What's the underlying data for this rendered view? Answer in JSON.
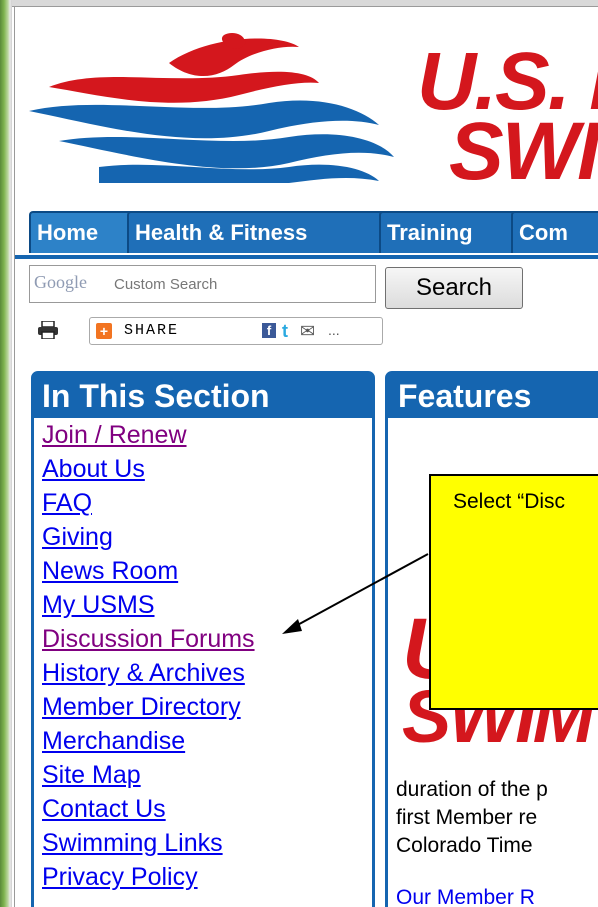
{
  "logo": {
    "line1": "U.S. M",
    "line2": "SWI"
  },
  "nav": {
    "tabs": [
      "Home",
      "Health & Fitness",
      "Training",
      "Com"
    ]
  },
  "search": {
    "google_text": "Google",
    "placeholder": "Custom Search",
    "button_label": "Search"
  },
  "share": {
    "label": "SHARE",
    "more": "..."
  },
  "section": {
    "title": "In This Section",
    "links": [
      {
        "label": "Join / Renew",
        "visited": true
      },
      {
        "label": "About Us",
        "visited": false
      },
      {
        "label": "FAQ",
        "visited": false
      },
      {
        "label": "Giving",
        "visited": false
      },
      {
        "label": "News Room",
        "visited": false
      },
      {
        "label": "My USMS",
        "visited": false
      },
      {
        "label": "Discussion Forums",
        "visited": true
      },
      {
        "label": "History & Archives",
        "visited": false
      },
      {
        "label": "Member Directory",
        "visited": false
      },
      {
        "label": "Merchandise",
        "visited": false
      },
      {
        "label": "Site Map",
        "visited": false
      },
      {
        "label": "Contact Us",
        "visited": false
      },
      {
        "label": "Swimming Links",
        "visited": false
      },
      {
        "label": "Privacy Policy",
        "visited": false
      }
    ]
  },
  "features": {
    "title": "Features",
    "logo_line1": "U",
    "logo_line2": "SWIM",
    "body_lines": [
      "duration of the p",
      "first Member re",
      "Colorado Time"
    ],
    "more_text": "Our Member R"
  },
  "callout": {
    "text": "Select “Disc"
  },
  "colors": {
    "brand_red": "#d4171d",
    "brand_blue": "#1565b0",
    "link": "#0000ee",
    "visited": "#800080",
    "callout": "#ffff00"
  }
}
